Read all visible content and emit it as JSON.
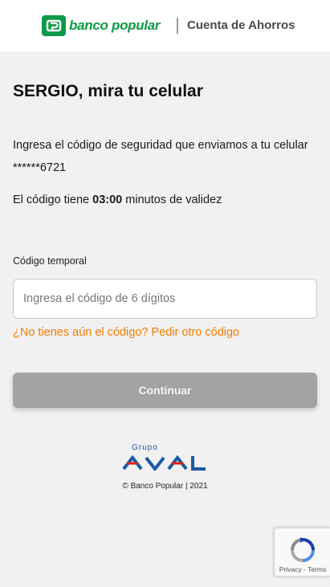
{
  "header": {
    "brand_name": "banco popular",
    "product": "Cuenta de Ahorros"
  },
  "main": {
    "title": "SERGIO, mira tu celular",
    "instruction": "Ingresa el código de seguridad que enviamos a tu celular ******6721",
    "validity_prefix": "El código tiene",
    "validity_time": "03:00",
    "validity_suffix": "minutos de validez",
    "field_label": "Código temporal",
    "code_input": {
      "value": "",
      "placeholder": "Ingresa el código de 6 dígitos"
    },
    "resend_link": "¿No tienes aún el código? Pedir otro código",
    "continue_label": "Continuar"
  },
  "footer": {
    "group_label": "Grupo",
    "aval_label": "AVAL",
    "copyright": "© Banco Popular | 2021"
  },
  "recaptcha": {
    "links": "Privacy - Terms"
  },
  "colors": {
    "brand_green": "#0d9a48",
    "link_orange": "#f07d00",
    "button_disabled": "#a3a3a3",
    "aval_blue": "#1a5aa6",
    "aval_red": "#e2231a"
  }
}
